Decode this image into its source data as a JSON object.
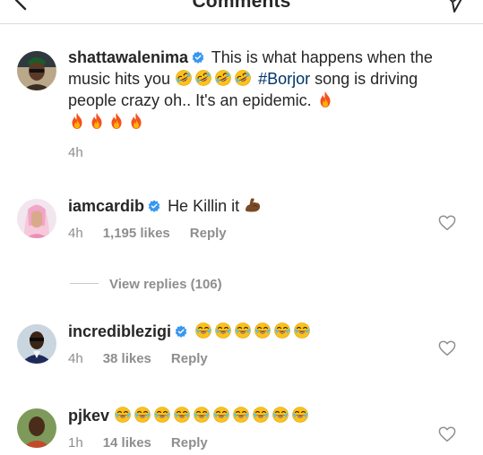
{
  "header": {
    "title": "Comments",
    "back_icon": "chevron-left-icon",
    "send_icon": "paper-plane-icon"
  },
  "comments": [
    {
      "username": "shattawalenima",
      "verified": true,
      "text_a": "This is what happens when the music hits you",
      "hashtag": "#Borjor",
      "text_b": "song is driving people crazy oh.. It's an epidemic.",
      "time": "4h"
    },
    {
      "username": "iamcardib",
      "verified": true,
      "text": "He Killin it",
      "time": "4h",
      "likes": "1,195 likes",
      "reply": "Reply"
    },
    {
      "username": "incrediblezigi",
      "verified": true,
      "time": "4h",
      "likes": "38 likes",
      "reply": "Reply"
    },
    {
      "username": "pjkev",
      "verified": false,
      "time": "1h",
      "likes": "14 likes",
      "reply": "Reply"
    }
  ],
  "view_replies": "View replies (106)",
  "colors": {
    "text": "#262626",
    "secondary": "#8e8e8e",
    "hashtag": "#003569",
    "verified": "#3897f0"
  }
}
